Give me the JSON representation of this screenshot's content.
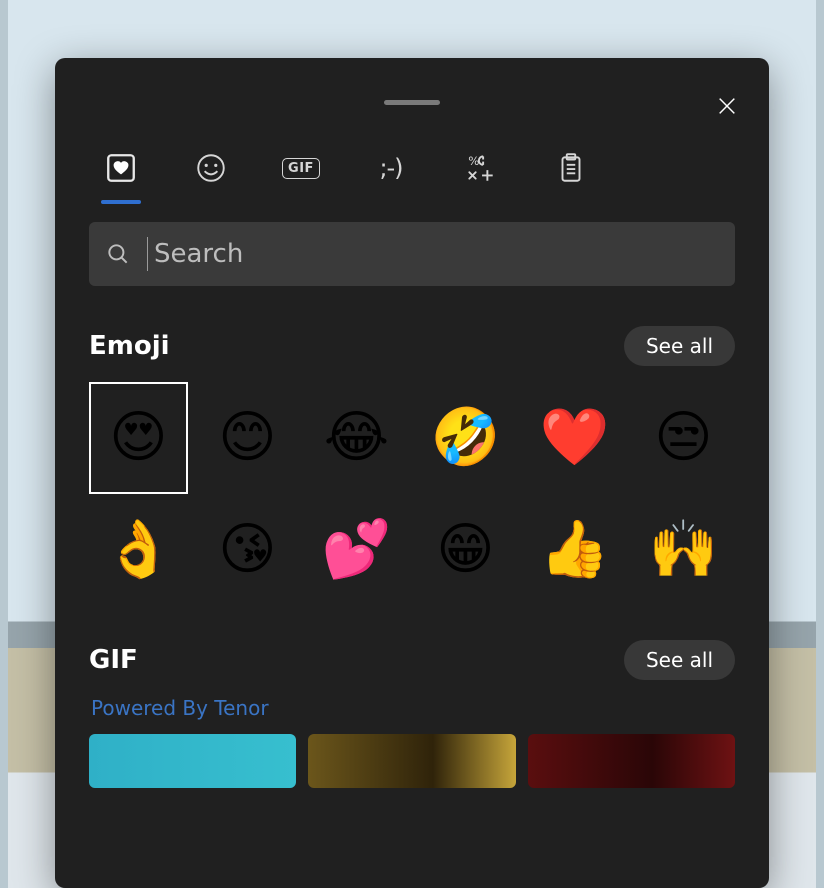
{
  "tabs": {
    "recent_icon": "square-heart-icon",
    "emoji_icon": "smiley-icon",
    "gif_icon": "gif-icon",
    "gif_label": "GIF",
    "kaomoji_icon": "kaomoji-icon",
    "kaomoji_label": ";-)",
    "symbols_icon": "symbols-icon",
    "clipboard_icon": "clipboard-icon",
    "active": "recent"
  },
  "search": {
    "placeholder": "Search",
    "value": ""
  },
  "sections": {
    "emoji": {
      "title": "Emoji",
      "see_all": "See all"
    },
    "gif": {
      "title": "GIF",
      "see_all": "See all",
      "attribution": "Powered By Tenor"
    }
  },
  "emoji_items": [
    {
      "name": "smiling-face-with-heart-eyes",
      "glyph": "😍",
      "selected": true
    },
    {
      "name": "smiling-face-with-smiling-eyes",
      "glyph": "😊"
    },
    {
      "name": "face-with-tears-of-joy",
      "glyph": "😂"
    },
    {
      "name": "rolling-on-the-floor-laughing",
      "glyph": "🤣"
    },
    {
      "name": "red-heart",
      "glyph": "❤️"
    },
    {
      "name": "unamused-face",
      "glyph": "😒"
    },
    {
      "name": "ok-hand",
      "glyph": "👌"
    },
    {
      "name": "face-blowing-a-kiss",
      "glyph": "😘"
    },
    {
      "name": "two-hearts",
      "glyph": "💕"
    },
    {
      "name": "beaming-face-with-smiling-eyes",
      "glyph": "😁"
    },
    {
      "name": "thumbs-up",
      "glyph": "👍"
    },
    {
      "name": "raising-hands",
      "glyph": "🙌"
    }
  ],
  "gif_items": [
    {
      "name": "gif-thumbnail-1"
    },
    {
      "name": "gif-thumbnail-2"
    },
    {
      "name": "gif-thumbnail-3"
    }
  ],
  "colors": {
    "panel_bg": "#202020",
    "accent": "#2f6fd0",
    "link": "#3a74c4"
  }
}
